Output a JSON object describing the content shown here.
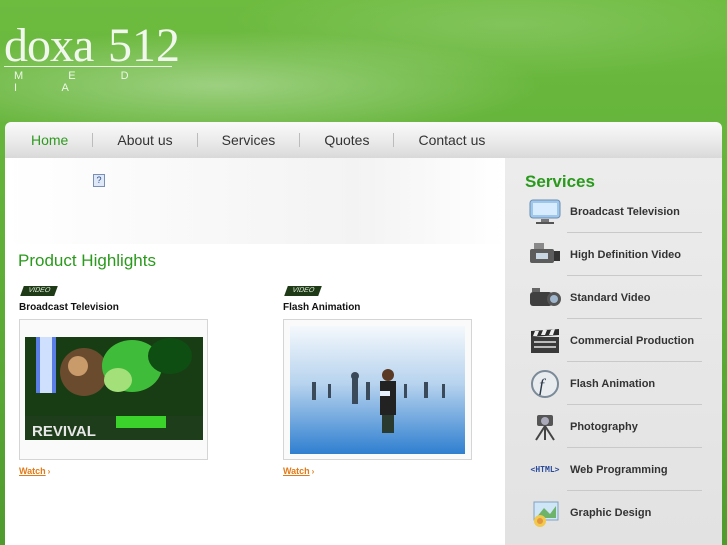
{
  "logo": {
    "word": "doxa",
    "number": "512",
    "tagline": "M E D I A"
  },
  "nav": [
    "Home",
    "About us",
    "Services",
    "Quotes",
    "Contact us"
  ],
  "nav_active": "Home",
  "main": {
    "highlights_title": "Product Highlights",
    "products": [
      {
        "tag": "VIDEO",
        "title": "Broadcast Television",
        "thumb_caption": "REVIVAL",
        "watch": "Watch"
      },
      {
        "tag": "VIDEO",
        "title": "Flash Animation",
        "watch": "Watch"
      }
    ]
  },
  "sidebar": {
    "title": "Services",
    "items": [
      {
        "label": "Broadcast Television",
        "icon": "tv-icon"
      },
      {
        "label": "High Definition Video",
        "icon": "hd-camera-icon"
      },
      {
        "label": "Standard Video",
        "icon": "video-camera-icon"
      },
      {
        "label": "Commercial Production",
        "icon": "clapperboard-icon"
      },
      {
        "label": "Flash Animation",
        "icon": "flash-icon"
      },
      {
        "label": "Photography",
        "icon": "camera-tripod-icon"
      },
      {
        "label": "Web Programming",
        "icon": "html-icon",
        "icon_text": "<HTML>"
      },
      {
        "label": "Graphic Design",
        "icon": "design-icon"
      }
    ]
  },
  "colors": {
    "brand_green": "#2a9a1c",
    "watch_orange": "#e37a17",
    "header_green": "#6dbb3f"
  }
}
